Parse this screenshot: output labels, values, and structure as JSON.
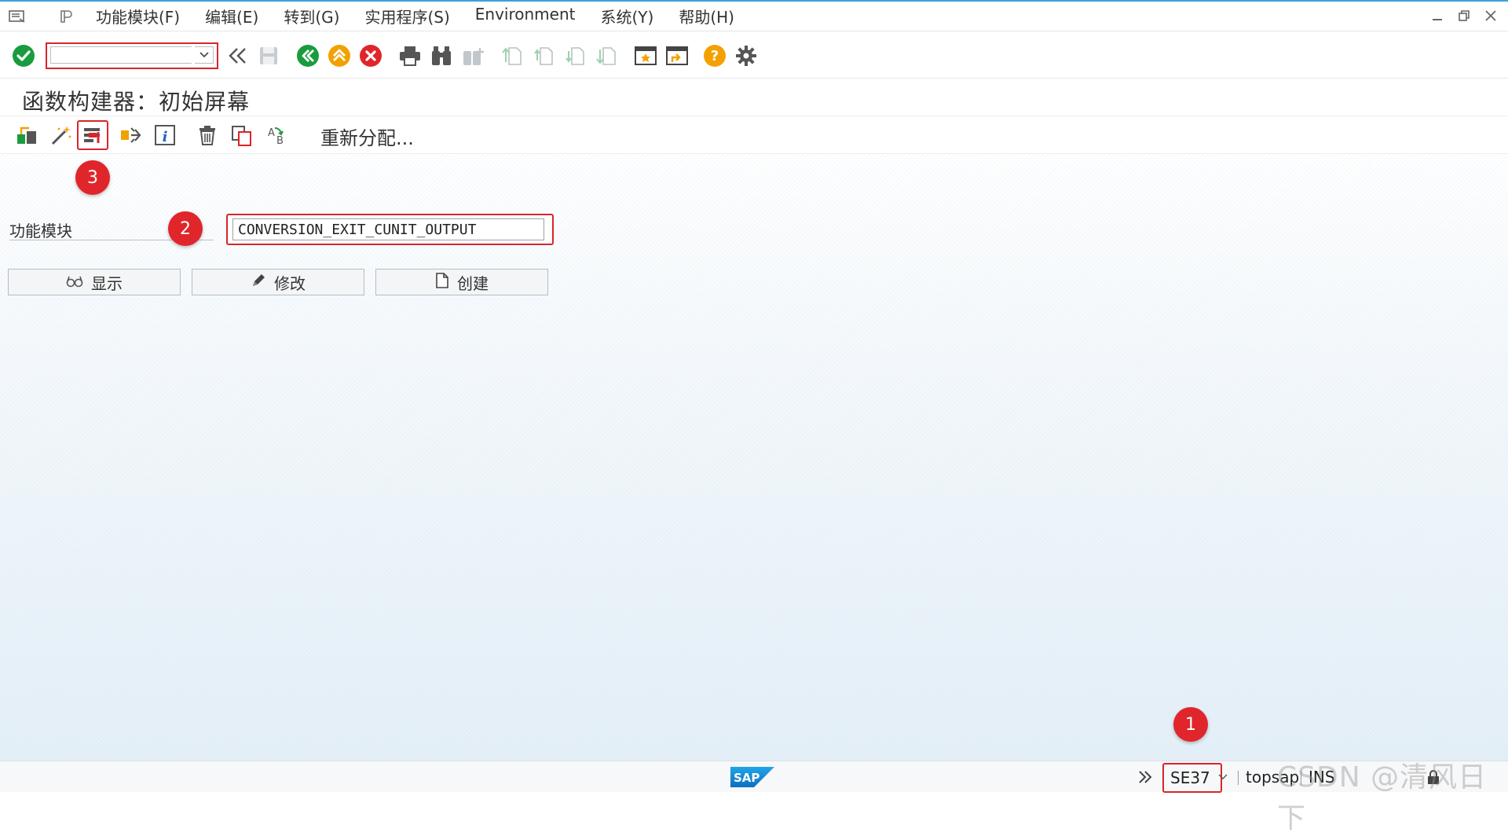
{
  "menubar": {
    "items": [
      "功能模块(F)",
      "编辑(E)",
      "转到(G)",
      "实用程序(S)",
      "Environment",
      "系统(Y)",
      "帮助(H)"
    ]
  },
  "toolbar": {
    "command_value": ""
  },
  "title": "函数构建器：初始屏幕",
  "app_toolbar": {
    "reassign_label": "重新分配..."
  },
  "form": {
    "function_module_label": "功能模块",
    "function_module_value": "CONVERSION_EXIT_CUNIT_OUTPUT"
  },
  "buttons": {
    "display": "显示",
    "change": "修改",
    "create": "创建"
  },
  "annotations": {
    "badge_1": "1",
    "badge_2": "2",
    "badge_3": "3"
  },
  "statusbar": {
    "transaction": "SE37",
    "server": "topsap",
    "mode": "INS"
  },
  "watermark": "CSDN @清风日下",
  "colors": {
    "accent_red": "#d9252a",
    "confirm_green": "#1a9c3e",
    "cancel_red": "#e0262b",
    "exit_orange": "#f2a100",
    "help_orange": "#f2a100"
  }
}
